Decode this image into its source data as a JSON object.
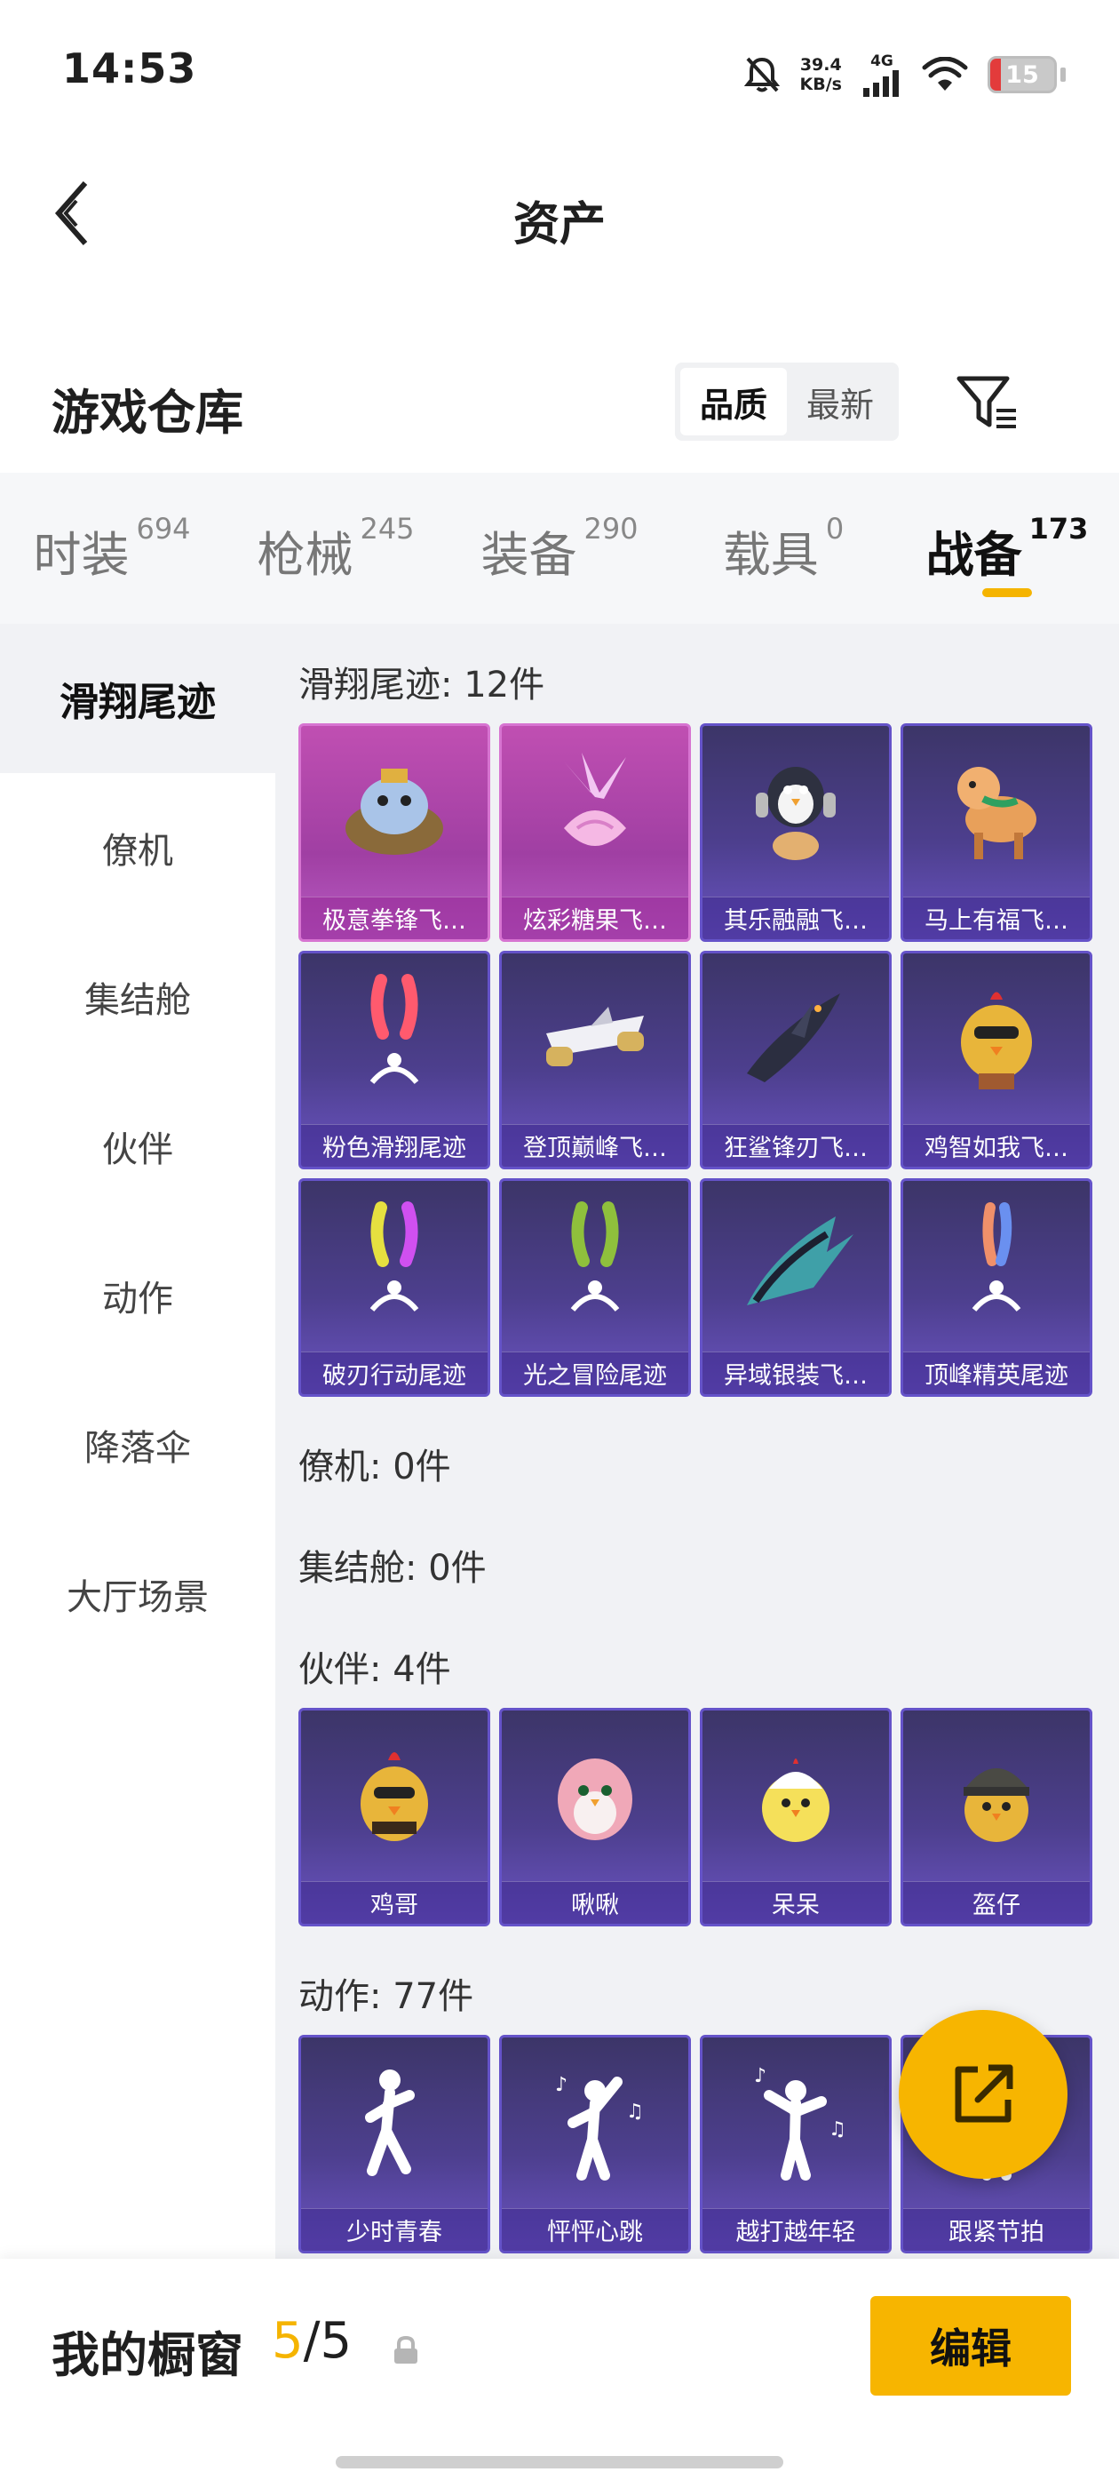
{
  "status_bar": {
    "time": "14:53",
    "net_speed_value": "39.4",
    "net_speed_unit": "KB/s",
    "network_type": "4G",
    "battery_level": "15"
  },
  "header": {
    "title": "资产"
  },
  "warehouse": {
    "title": "游戏仓库",
    "sort_options": [
      "品质",
      "最新"
    ]
  },
  "category_tabs": [
    {
      "label": "时装",
      "count": "694"
    },
    {
      "label": "枪械",
      "count": "245"
    },
    {
      "label": "装备",
      "count": "290"
    },
    {
      "label": "载具",
      "count": "0"
    },
    {
      "label": "战备",
      "count": "173"
    }
  ],
  "side_nav": [
    "滑翔尾迹",
    "僚机",
    "集结舱",
    "伙伴",
    "动作",
    "降落伞",
    "大厅场景"
  ],
  "sections": {
    "glide_trail": {
      "title": "滑翔尾迹: 12件",
      "items": [
        "极意拳锋飞…",
        "炫彩糖果飞…",
        "其乐融融飞…",
        "马上有福飞…",
        "粉色滑翔尾迹",
        "登顶巅峰飞…",
        "狂鲨锋刃飞…",
        "鸡智如我飞…",
        "破刃行动尾迹",
        "光之冒险尾迹",
        "异域银装飞…",
        "顶峰精英尾迹"
      ]
    },
    "wingman": {
      "title": "僚机: 0件"
    },
    "assembly_pod": {
      "title": "集结舱: 0件"
    },
    "companion": {
      "title": "伙伴: 4件",
      "items": [
        "鸡哥",
        "啾啾",
        "呆呆",
        "盔仔"
      ]
    },
    "emote": {
      "title": "动作: 77件",
      "items": [
        "少时青春",
        "怦怦心跳",
        "越打越年轻",
        "跟紧节拍"
      ]
    }
  },
  "bottom": {
    "showcase_label": "我的橱窗",
    "showcase_current": "5",
    "showcase_total": "/5",
    "edit_label": "编辑"
  },
  "colors": {
    "accent": "#f7b500",
    "card_purple": "#4d3f8e",
    "card_pink": "#c04fb2"
  }
}
